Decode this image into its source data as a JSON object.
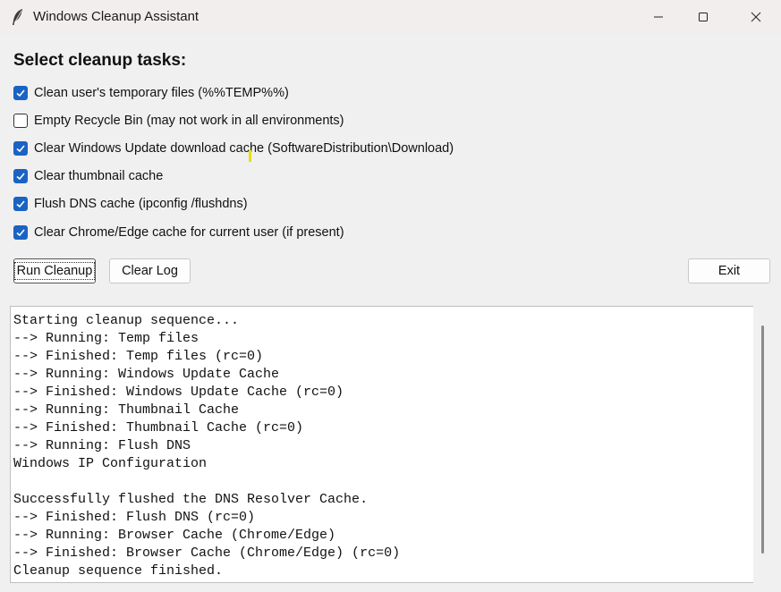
{
  "window": {
    "title": "Windows Cleanup Assistant",
    "icon": "feather-icon"
  },
  "heading": "Select cleanup tasks:",
  "tasks": [
    {
      "label": "Clean user's temporary files (%%TEMP%%)",
      "checked": true
    },
    {
      "label": "Empty Recycle Bin (may not work in all environments)",
      "checked": false
    },
    {
      "label": "Clear Windows Update download cache (SoftwareDistribution\\Download)",
      "checked": true
    },
    {
      "label": "Clear thumbnail cache",
      "checked": true
    },
    {
      "label": "Flush DNS cache (ipconfig /flushdns)",
      "checked": true
    },
    {
      "label": "Clear Chrome/Edge cache for current user (if present)",
      "checked": true
    }
  ],
  "buttons": {
    "run": "Run Cleanup",
    "clear_log": "Clear Log",
    "exit": "Exit"
  },
  "log": {
    "lines": [
      "Starting cleanup sequence...",
      "--> Running: Temp files",
      "--> Finished: Temp files (rc=0)",
      "--> Running: Windows Update Cache",
      "--> Finished: Windows Update Cache (rc=0)",
      "--> Running: Thumbnail Cache",
      "--> Finished: Thumbnail Cache (rc=0)",
      "--> Running: Flush DNS",
      "Windows IP Configuration",
      "",
      "Successfully flushed the DNS Resolver Cache.",
      "--> Finished: Flush DNS (rc=0)",
      "--> Running: Browser Cache (Chrome/Edge)",
      "--> Finished: Browser Cache (Chrome/Edge) (rc=0)",
      "Cleanup sequence finished."
    ]
  },
  "colors": {
    "accent": "#1a63c4",
    "titlebar": "#f3eeee",
    "window_bg": "#f0f0f0"
  }
}
